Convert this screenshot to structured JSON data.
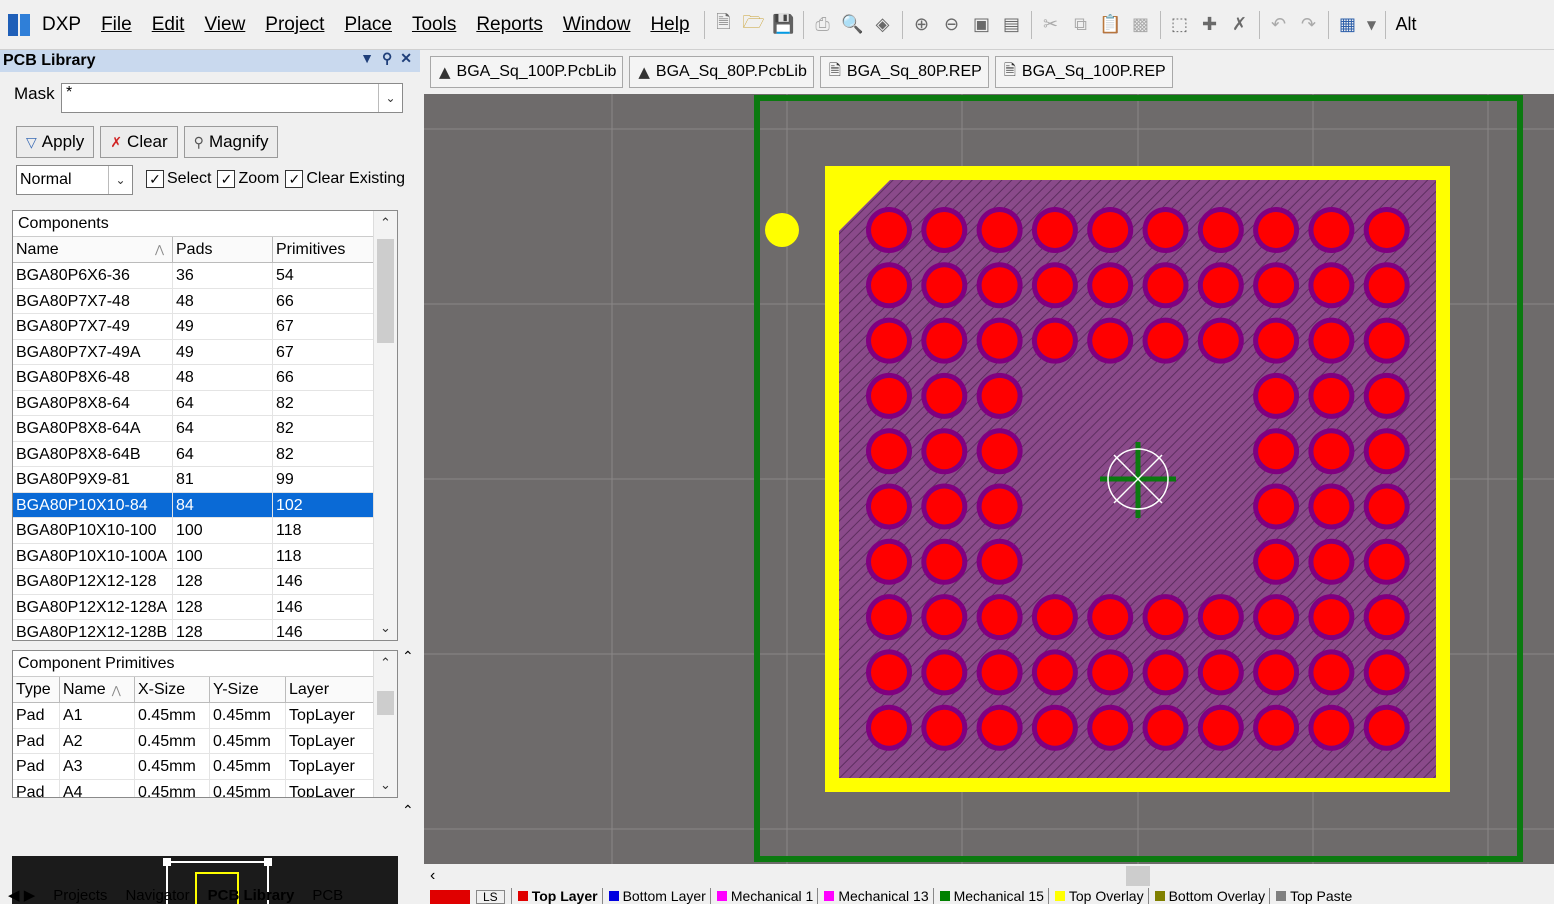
{
  "menu": {
    "app": "DXP",
    "items": [
      "File",
      "Edit",
      "View",
      "Project",
      "Place",
      "Tools",
      "Reports",
      "Window",
      "Help"
    ],
    "alt_label": "Alt"
  },
  "panel": {
    "title": "PCB Library",
    "mask_label": "Mask",
    "mask_value": "*",
    "apply_label": "Apply",
    "clear_label": "Clear",
    "magnify_label": "Magnify",
    "mode_value": "Normal",
    "select_label": "Select",
    "zoom_label": "Zoom",
    "clear_existing_label": "Clear Existing"
  },
  "components": {
    "header": "Components",
    "columns": [
      "Name",
      "Pads",
      "Primitives"
    ],
    "rows": [
      [
        "BGA80P6X6-36",
        "36",
        "54"
      ],
      [
        "BGA80P7X7-48",
        "48",
        "66"
      ],
      [
        "BGA80P7X7-49",
        "49",
        "67"
      ],
      [
        "BGA80P7X7-49A",
        "49",
        "67"
      ],
      [
        "BGA80P8X6-48",
        "48",
        "66"
      ],
      [
        "BGA80P8X8-64",
        "64",
        "82"
      ],
      [
        "BGA80P8X8-64A",
        "64",
        "82"
      ],
      [
        "BGA80P8X8-64B",
        "64",
        "82"
      ],
      [
        "BGA80P9X9-81",
        "81",
        "99"
      ],
      [
        "BGA80P10X10-84",
        "84",
        "102"
      ],
      [
        "BGA80P10X10-100",
        "100",
        "118"
      ],
      [
        "BGA80P10X10-100A",
        "100",
        "118"
      ],
      [
        "BGA80P12X12-128",
        "128",
        "146"
      ],
      [
        "BGA80P12X12-128A",
        "128",
        "146"
      ],
      [
        "BGA80P12X12-128B",
        "128",
        "146"
      ]
    ],
    "selected_index": 9
  },
  "primitives": {
    "header": "Component Primitives",
    "columns": [
      "Type",
      "Name",
      "X-Size",
      "Y-Size",
      "Layer"
    ],
    "rows": [
      [
        "Pad",
        "A1",
        "0.45mm",
        "0.45mm",
        "TopLayer"
      ],
      [
        "Pad",
        "A2",
        "0.45mm",
        "0.45mm",
        "TopLayer"
      ],
      [
        "Pad",
        "A3",
        "0.45mm",
        "0.45mm",
        "TopLayer"
      ],
      [
        "Pad",
        "A4",
        "0.45mm",
        "0.45mm",
        "TopLayer"
      ]
    ]
  },
  "panel_tabs": [
    "Projects",
    "Navigator",
    "PCB Library",
    "PCB"
  ],
  "doc_tabs": [
    "BGA_Sq_100P.PcbLib",
    "BGA_Sq_80P.PcbLib",
    "BGA_Sq_80P.REP",
    "BGA_Sq_100P.REP"
  ],
  "layers": {
    "ls_label": "LS",
    "items": [
      {
        "name": "Top Layer",
        "color": "#e00000",
        "active": true
      },
      {
        "name": "Bottom Layer",
        "color": "#0000e0"
      },
      {
        "name": "Mechanical 1",
        "color": "#ff00ff"
      },
      {
        "name": "Mechanical 13",
        "color": "#ff00ff"
      },
      {
        "name": "Mechanical 15",
        "color": "#008000"
      },
      {
        "name": "Top Overlay",
        "color": "#ffff00"
      },
      {
        "name": "Bottom Overlay",
        "color": "#808000"
      },
      {
        "name": "Top Paste",
        "color": "#808080"
      }
    ]
  },
  "pcb": {
    "colors": {
      "background": "#6e6b6b",
      "courtyard": "#0b7a10",
      "overlay": "#ffff00",
      "body": "#8a4a8a",
      "pad": "#ff0000",
      "pad_ring": "#800080"
    },
    "grid_rows": 10,
    "grid_cols": 10,
    "empty_rows": [
      3,
      4,
      5,
      6
    ],
    "empty_cols": [
      3,
      4,
      5,
      6
    ]
  }
}
